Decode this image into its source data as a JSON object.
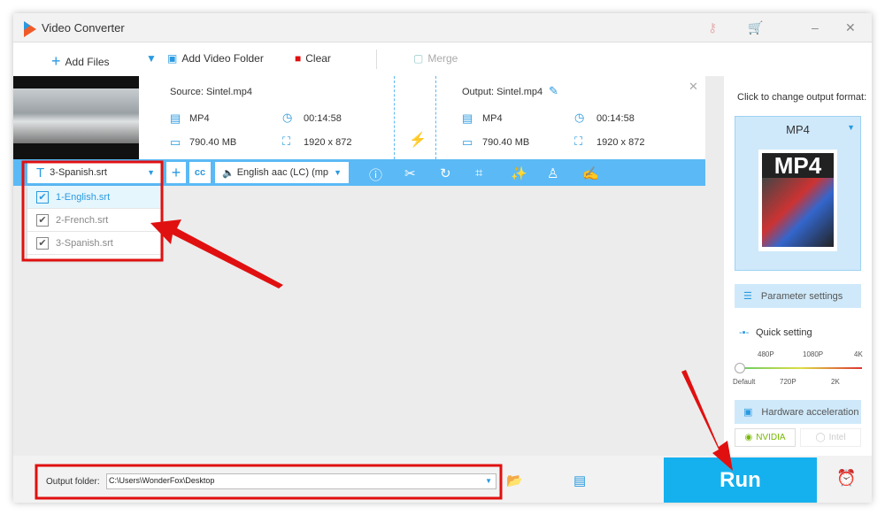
{
  "window": {
    "title": "Video Converter"
  },
  "toolbar": {
    "add_files": "Add Files",
    "add_folder": "Add Video Folder",
    "clear": "Clear",
    "merge": "Merge"
  },
  "item": {
    "source": "Source: Sintel.mp4",
    "output": "Output: Sintel.mp4",
    "src_format": "MP4",
    "src_duration": "00:14:58",
    "src_size": "790.40 MB",
    "src_resolution": "1920 x 872",
    "out_format": "MP4",
    "out_duration": "00:14:58",
    "out_size": "790.40 MB",
    "out_resolution": "1920 x 872"
  },
  "subtitle": {
    "selected": "3-Spanish.srt",
    "options": [
      {
        "label": "1-English.srt",
        "checked": true
      },
      {
        "label": "2-French.srt",
        "checked": true
      },
      {
        "label": "3-Spanish.srt",
        "checked": true
      }
    ]
  },
  "audio": {
    "selected": "English aac (LC) (mp"
  },
  "right": {
    "hint": "Click to change output format:",
    "format": "MP4",
    "format_icon_text": "MP4",
    "param": "Parameter settings",
    "quick": "Quick setting",
    "quality_top": [
      "480P",
      "1080P",
      "4K"
    ],
    "quality_bottom": [
      "Default",
      "720P",
      "2K"
    ],
    "quality_value": "Default",
    "hw": "Hardware acceleration",
    "nvidia": "NVIDIA",
    "intel": "Intel"
  },
  "bottom": {
    "label": "Output folder:",
    "path": "C:\\Users\\WonderFox\\Desktop",
    "run": "Run"
  },
  "colors": {
    "accent": "#15b1ef",
    "bar": "#5bb9f5",
    "annotation": "#e01010"
  }
}
